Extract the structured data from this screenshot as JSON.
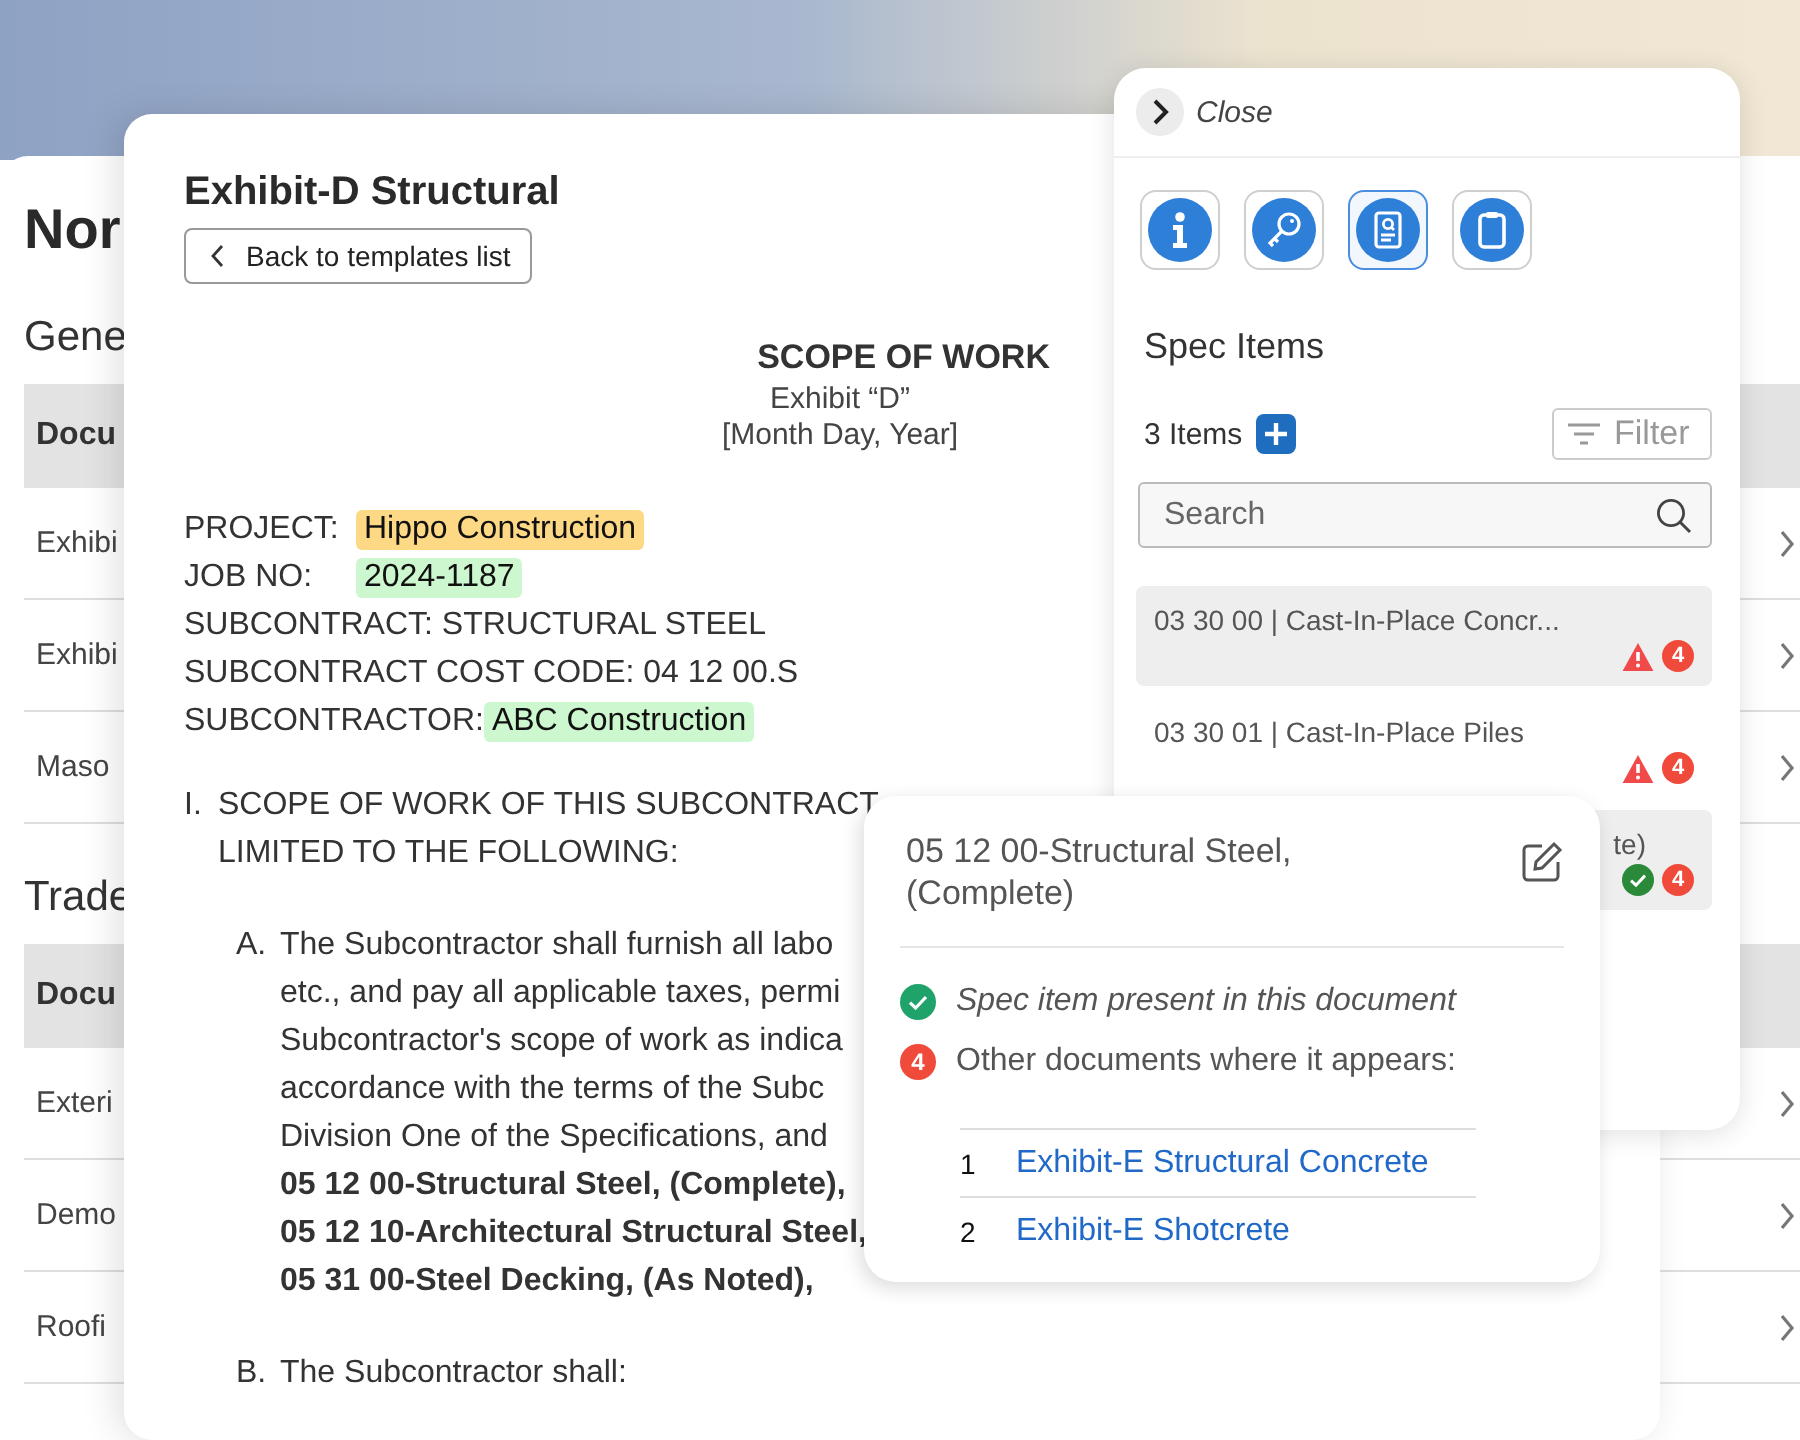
{
  "background_page": {
    "title": "Nor",
    "sections": [
      {
        "heading": "Gene",
        "column": "Docu",
        "rows": [
          "Exhibi",
          "Exhibi",
          "Maso"
        ]
      },
      {
        "heading": "Trade",
        "column": "Docu",
        "rows": [
          "Exteri",
          "Demo",
          "Roofi"
        ]
      }
    ]
  },
  "document": {
    "title": "Exhibit-D Structural",
    "back_button": "Back to templates list",
    "heading": "SCOPE OF WORK",
    "subheading": [
      "Exhibit “D”",
      "[Month Day, Year]"
    ],
    "fields": [
      {
        "label": "PROJECT:",
        "value": "Hippo Construction",
        "color": "#fdd885"
      },
      {
        "label": "JOB NO:",
        "value": "2024-1187",
        "color": "#ccf7cf"
      },
      {
        "label": "SUBCONTRACT: STRUCTURAL STEEL"
      },
      {
        "label": "SUBCONTRACT COST CODE: 04 12 00.S"
      },
      {
        "label": "SUBCONTRACTOR:",
        "value": "ABC Construction",
        "color": "#ccf7cf"
      }
    ],
    "sections": [
      {
        "marker": "I.",
        "lines": [
          {
            "text": "SCOPE OF WORK OF THIS SUBCONTRACT",
            "bold": false
          },
          {
            "text": "LIMITED TO THE FOLLOWING:",
            "bold": false
          }
        ],
        "items": [
          {
            "marker": "A.",
            "lines": [
              {
                "text": "The Subcontractor shall furnish all labo",
                "bold": false
              },
              {
                "text": "etc., and pay all applicable taxes, permi",
                "bold": false
              },
              {
                "text": "Subcontractor's scope of work as indica",
                "bold": false
              },
              {
                "text": "accordance with the terms of the Subc",
                "bold": false
              },
              {
                "text": "Division One of the Specifications, and",
                "bold": false
              },
              {
                "text": "05 12 00-Structural Steel, (Complete),",
                "bold": true
              },
              {
                "text": "05 12 10-Architectural Structural Steel,",
                "bold": true
              },
              {
                "text": "05 31 00-Steel Decking, (As Noted),",
                "bold": true
              }
            ]
          },
          {
            "marker": "B.",
            "lines": [
              {
                "text": "The Subcontractor shall:",
                "bold": false
              }
            ]
          }
        ]
      }
    ]
  },
  "spec_panel": {
    "close": "Close",
    "tools": [
      {
        "kind": "info",
        "selected": false
      },
      {
        "kind": "key",
        "selected": false
      },
      {
        "kind": "document",
        "selected": true
      },
      {
        "kind": "clipboard",
        "selected": false
      }
    ],
    "title": "Spec Items",
    "count": "3 Items",
    "filter": "Filter",
    "search": {
      "placeholder": "Search"
    },
    "items": [
      {
        "kind": "full",
        "text": "03 30 00 | Cast-In-Place Concr...",
        "present": false,
        "badge": "4",
        "selected": true
      },
      {
        "kind": "full",
        "text": "03 30 01 | Cast-In-Place Piles",
        "present": false,
        "badge": "4",
        "selected": false
      },
      {
        "kind": "cut",
        "text": "te)",
        "present": true,
        "badge": "4",
        "selected": true
      }
    ]
  },
  "popover": {
    "title": "05 12 00-Structural Steel, (Complete)",
    "notes": [
      {
        "kind": "check",
        "text": "Spec item present in this document"
      },
      {
        "kind": "badge",
        "badge": "4",
        "text": "Other documents where it appears:"
      }
    ],
    "links": [
      {
        "index": "1",
        "text": "Exhibit-E Structural Concrete"
      },
      {
        "index": "2",
        "text": "Exhibit-E Shotcrete"
      }
    ]
  }
}
